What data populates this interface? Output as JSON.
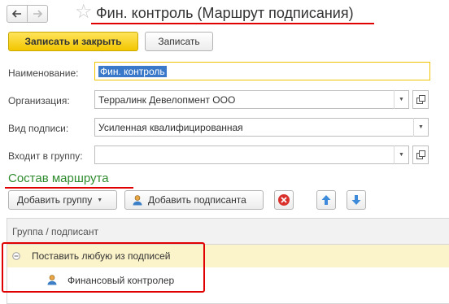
{
  "window": {
    "title": "Фин. контроль (Маршрут подписания)"
  },
  "toolbar": {
    "save_close_label": "Записать и закрыть",
    "save_label": "Записать"
  },
  "form": {
    "name": {
      "label": "Наименование:",
      "value": "Фин. контроль"
    },
    "organization": {
      "label": "Организация:",
      "value": "Терралинк Девелопмент ООО"
    },
    "signature_type": {
      "label": "Вид подписи:",
      "value": "Усиленная квалифицированная"
    },
    "group": {
      "label": "Входит в группу:",
      "value": ""
    }
  },
  "route": {
    "section_title": "Состав маршрута",
    "add_group_label": "Добавить группу",
    "add_signer_label": "Добавить подписанта",
    "table": {
      "header": "Группа / подписант",
      "rows": [
        {
          "label": "Поставить любую из подписей",
          "type": "group"
        },
        {
          "label": "Финансовый контролер",
          "type": "signer"
        }
      ]
    }
  },
  "colors": {
    "accent_yellow": "#f2c600",
    "annotation_red": "#e00000",
    "section_green": "#2e8b2e",
    "selection_blue": "#3a78c9"
  }
}
